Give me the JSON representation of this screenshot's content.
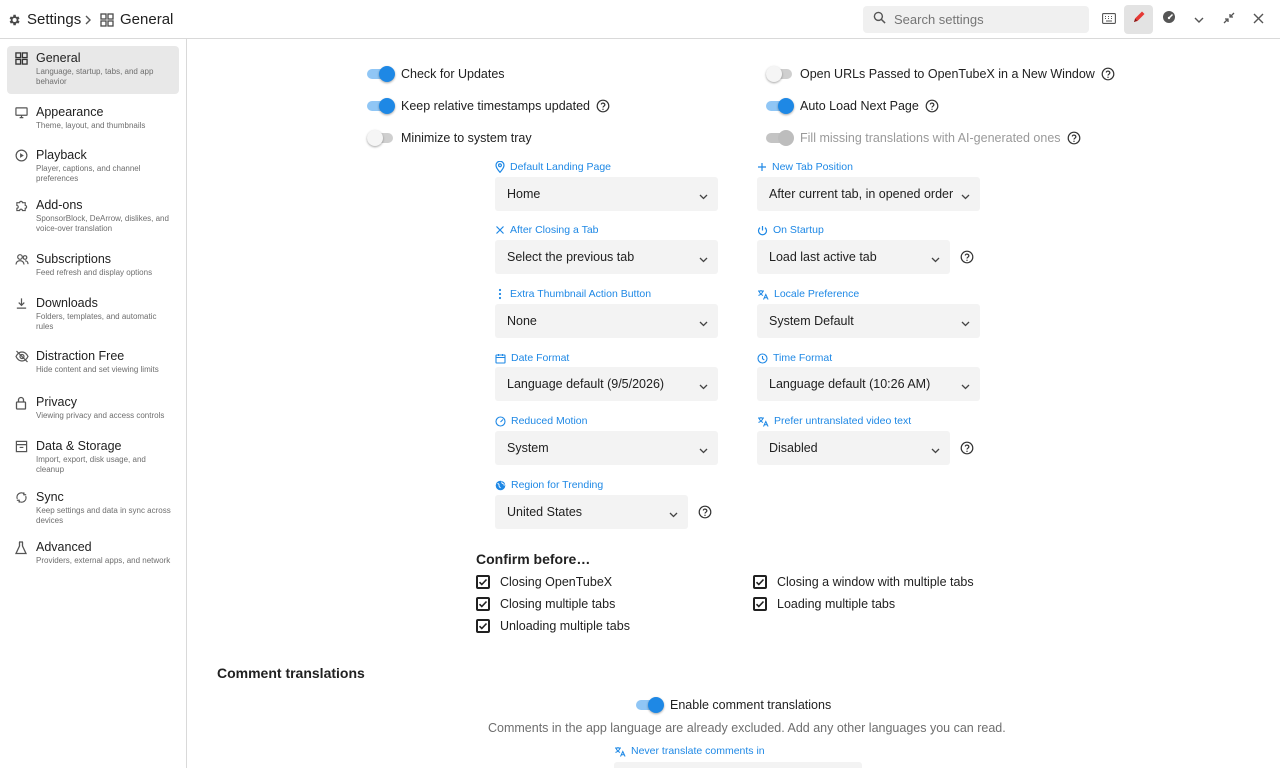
{
  "header": {
    "root": "Settings",
    "current": "General",
    "search_placeholder": "Search settings"
  },
  "sidebar": {
    "items": [
      {
        "title": "General",
        "desc": "Language, startup, tabs, and app behavior"
      },
      {
        "title": "Appearance",
        "desc": "Theme, layout, and thumbnails"
      },
      {
        "title": "Playback",
        "desc": "Player, captions, and channel preferences"
      },
      {
        "title": "Add-ons",
        "desc": "SponsorBlock, DeArrow, dislikes, and voice-over translation"
      },
      {
        "title": "Subscriptions",
        "desc": "Feed refresh and display options"
      },
      {
        "title": "Downloads",
        "desc": "Folders, templates, and automatic rules"
      },
      {
        "title": "Distraction Free",
        "desc": "Hide content and set viewing limits"
      },
      {
        "title": "Privacy",
        "desc": "Viewing privacy and access controls"
      },
      {
        "title": "Data & Storage",
        "desc": "Import, export, disk usage, and cleanup"
      },
      {
        "title": "Sync",
        "desc": "Keep settings and data in sync across devices"
      },
      {
        "title": "Advanced",
        "desc": "Providers, external apps, and network"
      }
    ]
  },
  "toggles": {
    "check_updates": "Check for Updates",
    "relative_timestamps": "Keep relative timestamps updated",
    "minimize_tray": "Minimize to system tray",
    "open_urls_new_window": "Open URLs Passed to OpenTubeX in a New Window",
    "auto_load_next": "Auto Load Next Page",
    "fill_translations": "Fill missing translations with AI-generated ones"
  },
  "fields": {
    "landing_page": {
      "label": "Default Landing Page",
      "value": "Home"
    },
    "new_tab_position": {
      "label": "New Tab Position",
      "value": "After current tab, in opened order"
    },
    "after_closing_tab": {
      "label": "After Closing a Tab",
      "value": "Select the previous tab"
    },
    "on_startup": {
      "label": "On Startup",
      "value": "Load last active tab"
    },
    "thumbnail_action": {
      "label": "Extra Thumbnail Action Button",
      "value": "None"
    },
    "locale": {
      "label": "Locale Preference",
      "value": "System Default"
    },
    "date_format": {
      "label": "Date Format",
      "value": "Language default (9/5/2026)"
    },
    "time_format": {
      "label": "Time Format",
      "value": "Language default (10:26 AM)"
    },
    "reduced_motion": {
      "label": "Reduced Motion",
      "value": "System"
    },
    "untranslated_text": {
      "label": "Prefer untranslated video text",
      "value": "Disabled"
    },
    "region_trending": {
      "label": "Region for Trending",
      "value": "United States"
    }
  },
  "confirm": {
    "title": "Confirm before…",
    "closing_app": "Closing OpenTubeX",
    "closing_window": "Closing a window with multiple tabs",
    "closing_multiple": "Closing multiple tabs",
    "loading_multiple": "Loading multiple tabs",
    "unloading_multiple": "Unloading multiple tabs"
  },
  "comments": {
    "title": "Comment translations",
    "enable": "Enable comment translations",
    "note": "Comments in the app language are already excluded. Add any other languages you can read.",
    "never_translate": "Never translate comments in"
  },
  "colors": {
    "accent": "#1e88e5",
    "accent_track": "#90c6f5",
    "pen_active": "#e53935"
  }
}
